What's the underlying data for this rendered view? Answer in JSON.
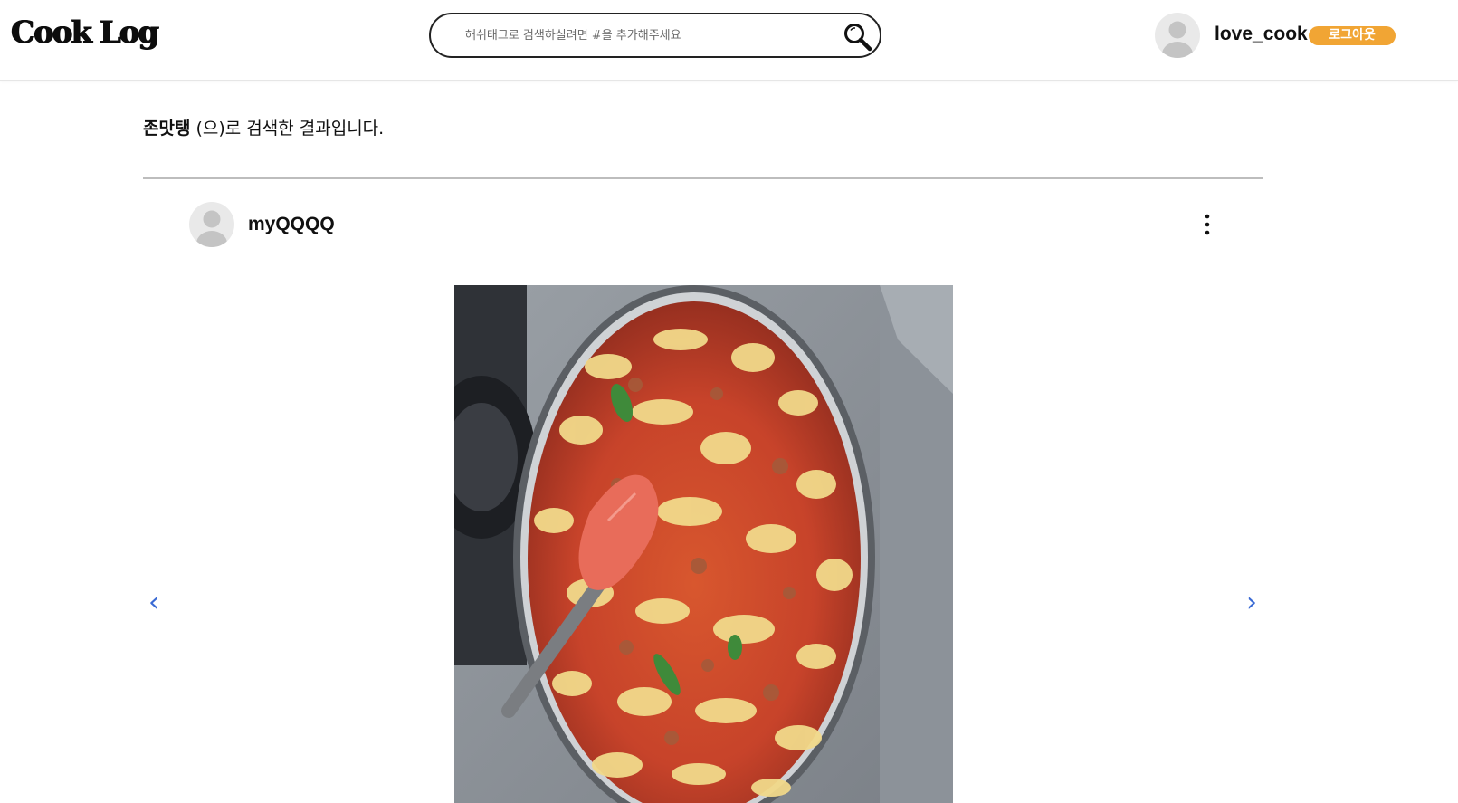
{
  "header": {
    "logo": "Cook Log",
    "search": {
      "placeholder": "해쉬태그로 검색하실려면 #을 추가해주세요",
      "value": ""
    },
    "user": {
      "username": "love_cook",
      "logout_label": "로그아웃"
    }
  },
  "results": {
    "keyword": "존맛탱",
    "suffix": "(으)로 검색한 결과입니다."
  },
  "post": {
    "author": "myQQQQ",
    "more_icon": "more-vertical-icon",
    "prev_label": "‹",
    "next_label": "›"
  },
  "colors": {
    "accent": "#f1a534",
    "carousel_arrow": "#3a6ad4",
    "divider": "#bdbdbd"
  }
}
